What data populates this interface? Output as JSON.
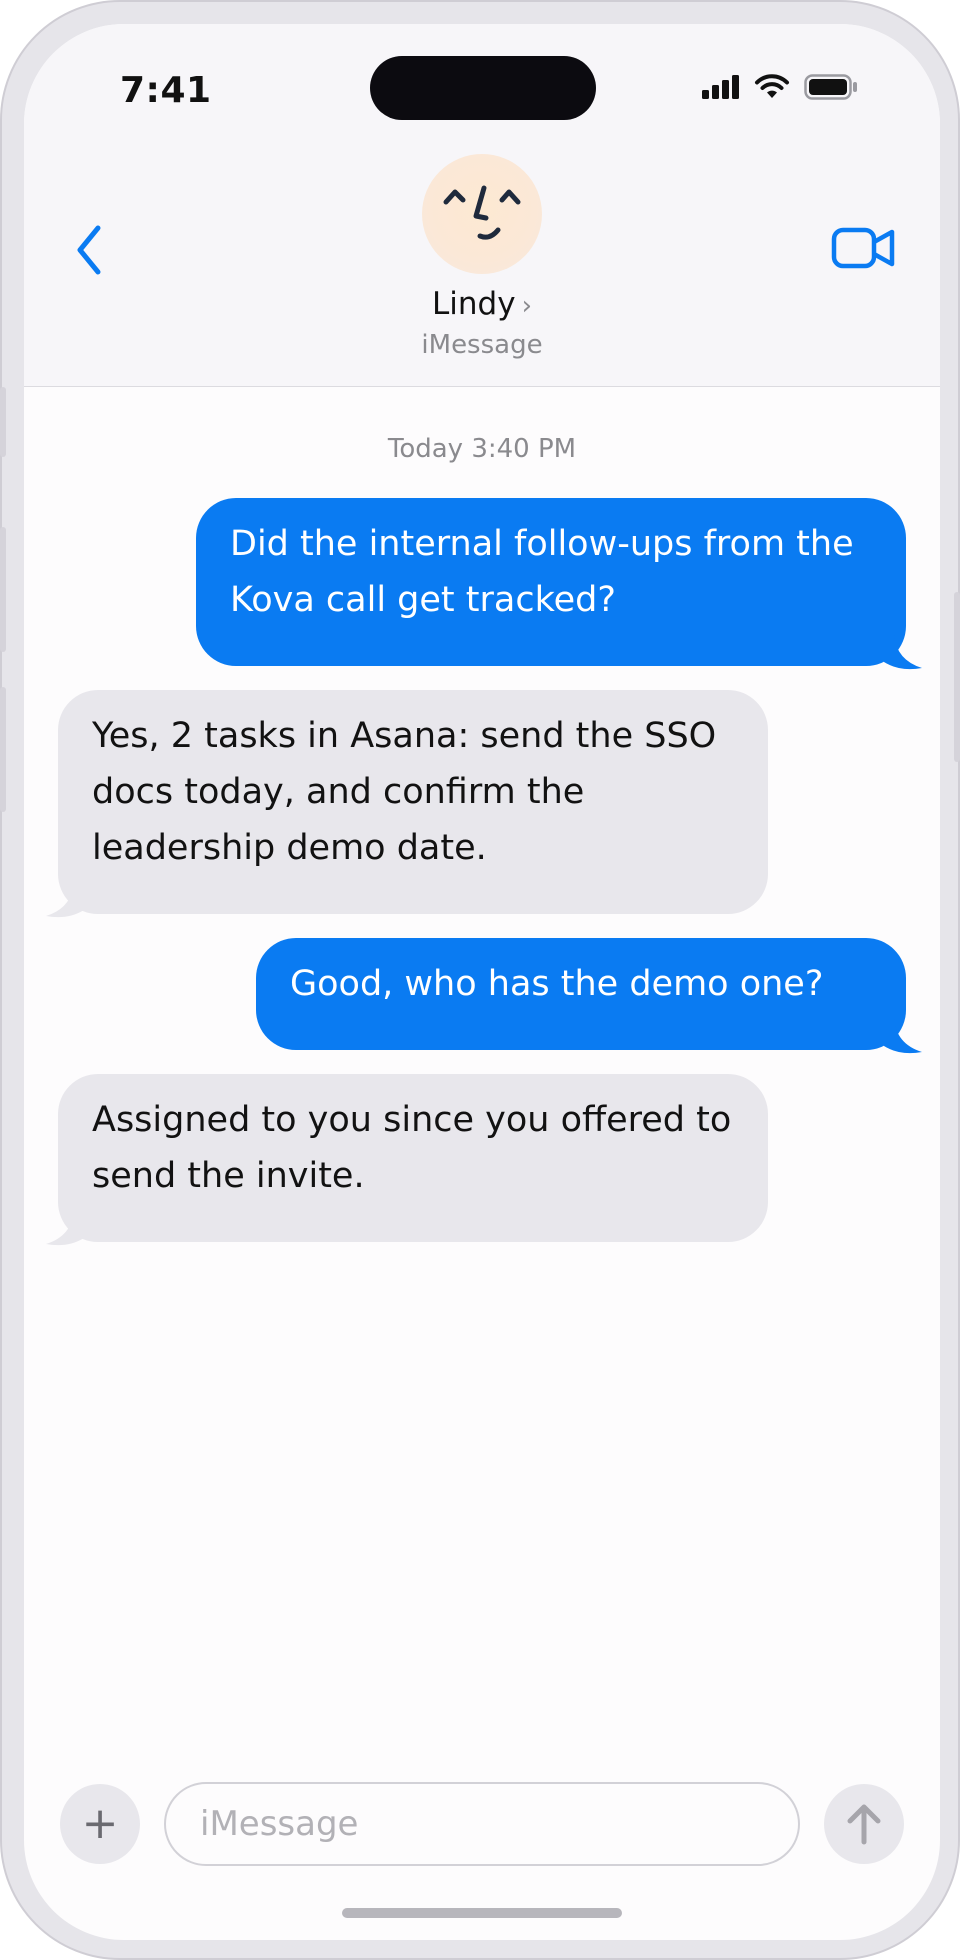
{
  "status_bar": {
    "time": "7:41",
    "icons": [
      "cellular-signal-icon",
      "wifi-icon",
      "battery-icon"
    ]
  },
  "header": {
    "back_icon": "chevron-left-icon",
    "contact_name": "Lindy",
    "contact_chevron": "›",
    "service_label": "iMessage",
    "video_icon": "video-camera-icon",
    "avatar_icon": "smiling-face-icon"
  },
  "conversation": {
    "timestamp": "Today 3:40 PM",
    "messages": [
      {
        "direction": "outgoing",
        "text": "Did the internal follow-ups from the Kova call get tracked?"
      },
      {
        "direction": "incoming",
        "text": "Yes, 2 tasks in Asana: send the SSO docs today, and confirm the leadership demo date."
      },
      {
        "direction": "outgoing",
        "text": "Good, who has the demo one?"
      },
      {
        "direction": "incoming",
        "text": "Assigned to you since you offered to send the invite."
      }
    ]
  },
  "composer": {
    "plus_label": "+",
    "placeholder": "iMessage",
    "value": "",
    "send_icon": "arrow-up-icon"
  },
  "colors": {
    "outgoing_bubble": "#0a7bf2",
    "incoming_bubble": "#e8e7ec",
    "accent": "#0a7bf2"
  }
}
